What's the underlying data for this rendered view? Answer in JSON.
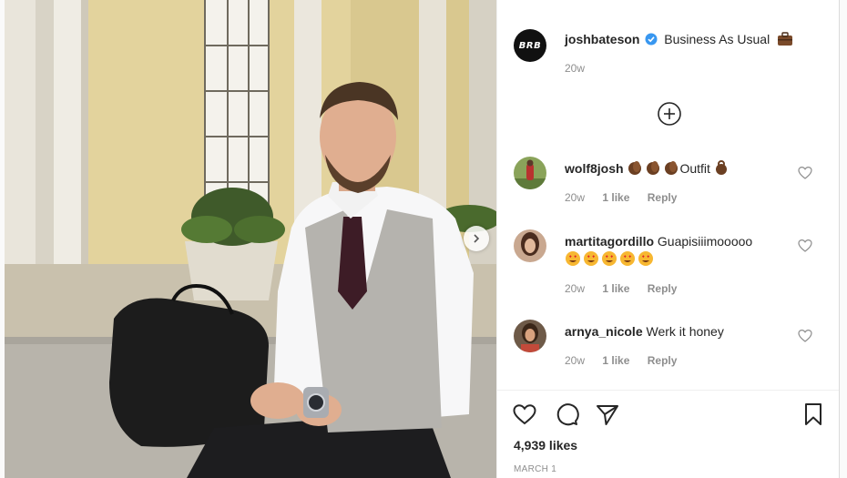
{
  "post": {
    "author": {
      "avatar_text": "BRB",
      "username": "joshbateson",
      "verified": true
    },
    "caption": "Business As Usual",
    "caption_emoji": "briefcase-emoji",
    "caption_time": "20w",
    "load_more_icon": "plus-circle-icon",
    "comments": [
      {
        "username": "wolf8josh",
        "text": "Outfit",
        "emoji_before": [
          "clapping-hands-emoji",
          "clapping-hands-emoji",
          "clapping-hands-emoji"
        ],
        "emoji_after": [
          "ok-hand-emoji"
        ],
        "time": "20w",
        "likes": "1 like",
        "reply": "Reply"
      },
      {
        "username": "martitagordillo",
        "text": "Guapisiiimooooo",
        "emoji_after": [
          "heart-eyes-emoji",
          "heart-eyes-emoji",
          "heart-eyes-emoji",
          "heart-eyes-emoji",
          "heart-eyes-emoji"
        ],
        "time": "20w",
        "likes": "1 like",
        "reply": "Reply"
      },
      {
        "username": "arnya_nicole",
        "text": "Werk it honey",
        "time": "20w",
        "likes": "1 like",
        "reply": "Reply"
      }
    ],
    "actions": [
      "heart-icon",
      "comment-icon",
      "share-icon",
      "bookmark-icon"
    ],
    "likes_count": "4,939 likes",
    "date": "MARCH 1"
  },
  "colors": {
    "verified_blue": "#3897f0",
    "text_primary": "#262626",
    "text_secondary": "#8e8e8e"
  }
}
